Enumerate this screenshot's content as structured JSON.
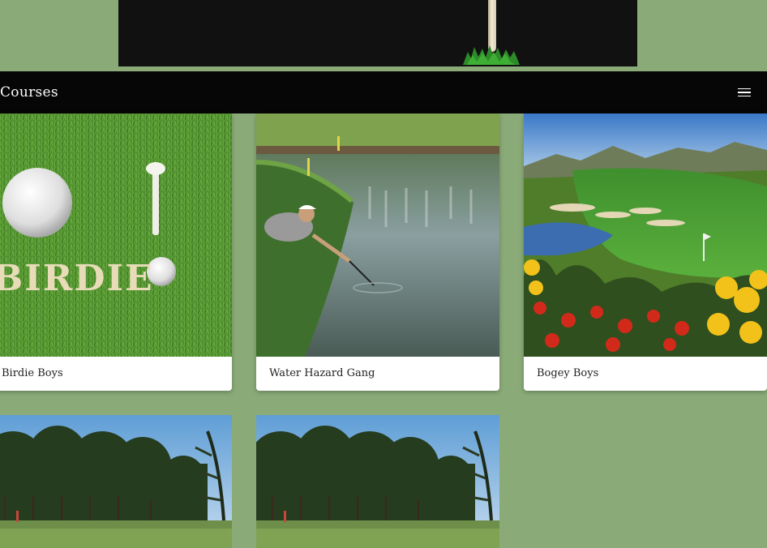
{
  "navbar": {
    "title": "Courses",
    "menu_icon": "hamburger-menu-icon"
  },
  "colors": {
    "page_background": "#8aab78",
    "navbar_background": "#060606",
    "banner_background": "#111111"
  },
  "cards": [
    {
      "title": "Birdie Boys",
      "image": "golf ball, tee and BIRDIE letters on grass"
    },
    {
      "title": "Water Hazard Gang",
      "image": "golfer retrieving ball from pond"
    },
    {
      "title": "Bogey Boys",
      "image": "desert golf course with flowers"
    },
    {
      "title": "",
      "image": "tree-lined fairway"
    },
    {
      "title": "",
      "image": "tree-lined fairway"
    }
  ],
  "banner": {
    "image": "golf tee in grass"
  }
}
